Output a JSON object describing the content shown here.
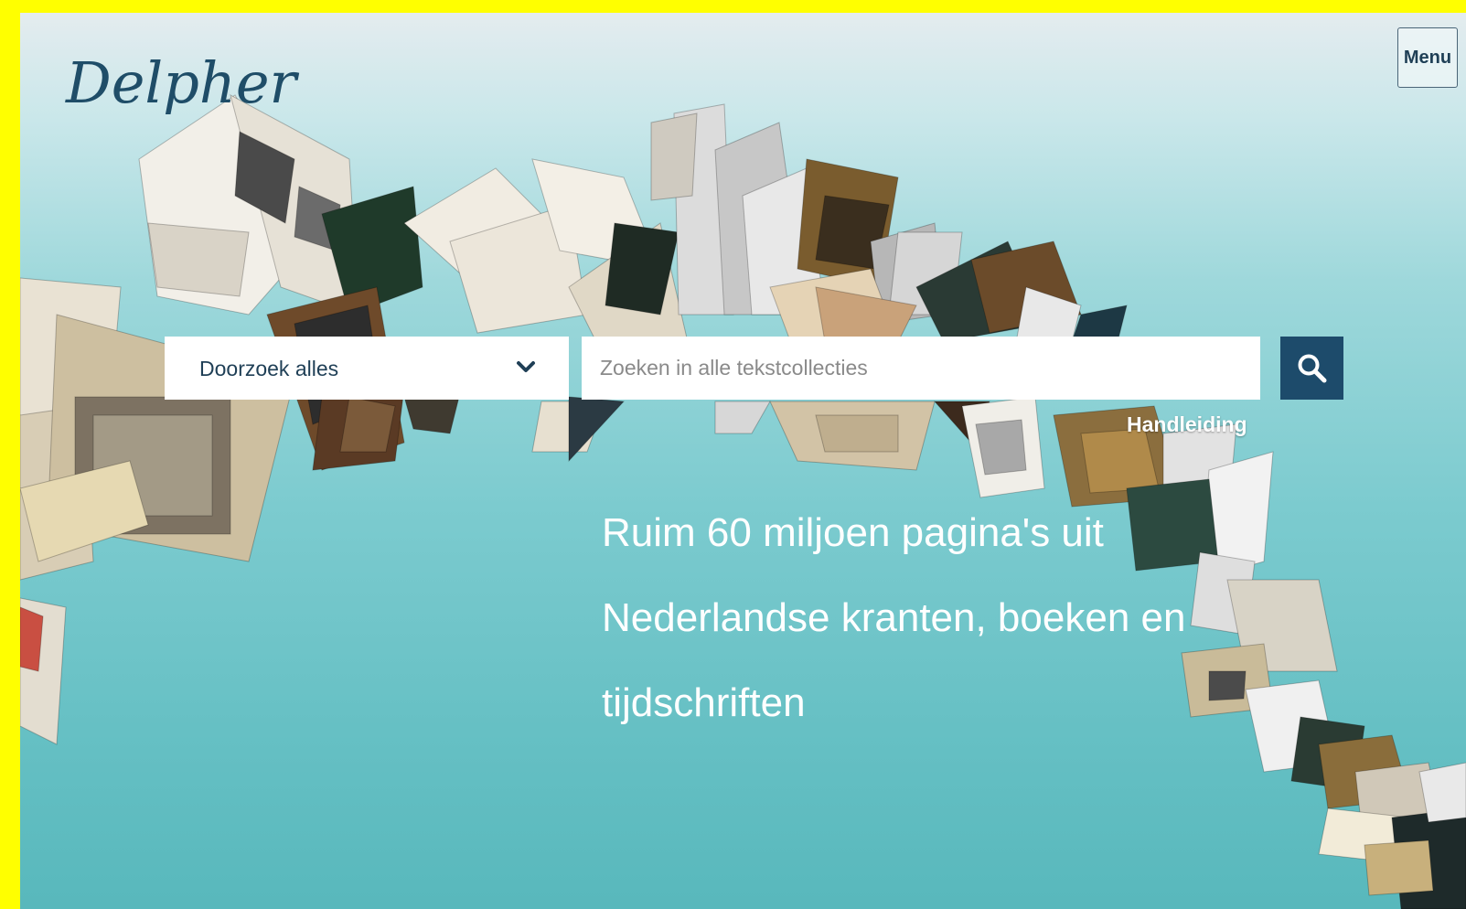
{
  "brand": {
    "logo_text": "Delpher",
    "logo_color": "#1f4d68"
  },
  "header": {
    "menu_label": "Menu"
  },
  "search": {
    "scope_selected": "Doorzoek alles",
    "placeholder": "Zoeken in alle tekstcollecties",
    "value": "",
    "help_link": "Handleiding"
  },
  "hero": {
    "tagline": "Ruim 60 miljoen pagina's uit Nederlandse kranten, boeken en tijdschriften"
  },
  "icons": {
    "search_button": "search-icon",
    "scope_dropdown": "chevron-down-icon"
  },
  "colors": {
    "frame": "#ffff00",
    "accent": "#1d4b6b",
    "background_top": "#e4ecef",
    "background_bottom": "#58b8bc"
  }
}
